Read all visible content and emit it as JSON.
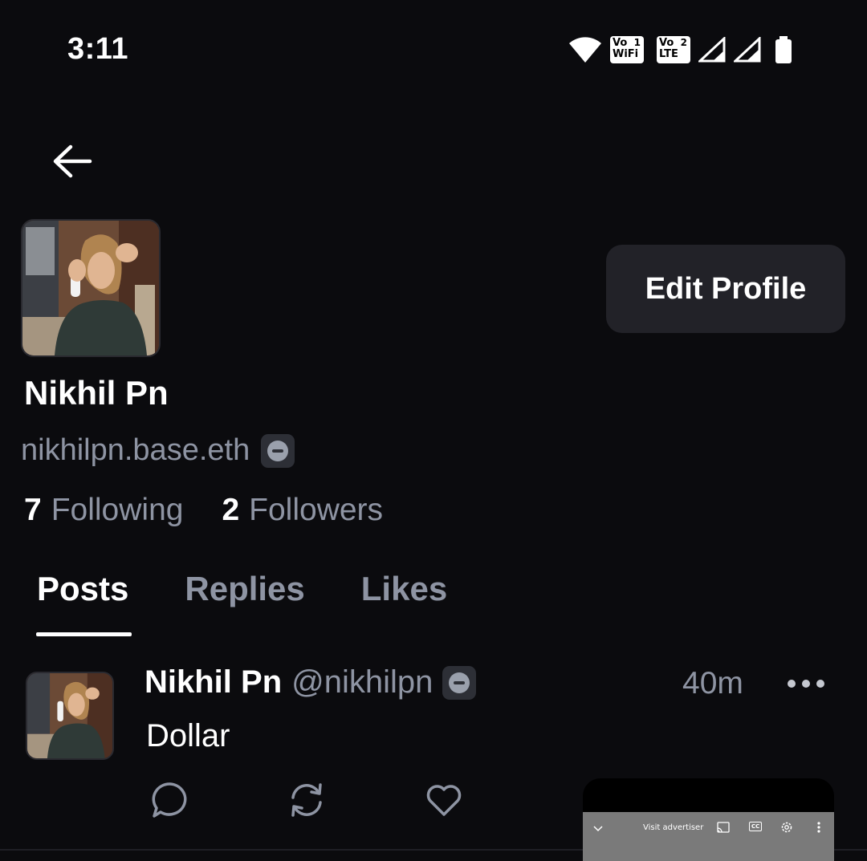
{
  "status_bar": {
    "time": "3:11",
    "volte1": {
      "label": "Vo WiFi",
      "top": "Vo",
      "bottom": "WiFi",
      "num": "1"
    },
    "volte2": {
      "label": "Vo LTE",
      "top": "Vo",
      "bottom": "LTE",
      "num": "2"
    },
    "icons": [
      "wifi-icon",
      "signal-icon",
      "signal-icon",
      "battery-icon"
    ]
  },
  "profile": {
    "name": "Nikhil Pn",
    "handle": "nikhilpn.base.eth",
    "edit_button": "Edit Profile",
    "following_count": "7",
    "following_label": "Following",
    "followers_count": "2",
    "followers_label": "Followers"
  },
  "tabs": [
    {
      "label": "Posts",
      "active": true
    },
    {
      "label": "Replies",
      "active": false
    },
    {
      "label": "Likes",
      "active": false
    }
  ],
  "post": {
    "author_name": "Nikhil Pn",
    "author_handle": "@nikhilpn",
    "time": "40m",
    "text": "Dollar",
    "actions": [
      "reply-icon",
      "recast-icon",
      "like-icon"
    ]
  },
  "mini_player": {
    "visit_label": "Visit advertiser",
    "cc_label": "CC"
  },
  "colors": {
    "background": "#0b0b0e",
    "muted_text": "#8e94a3",
    "button_bg": "#222228"
  }
}
